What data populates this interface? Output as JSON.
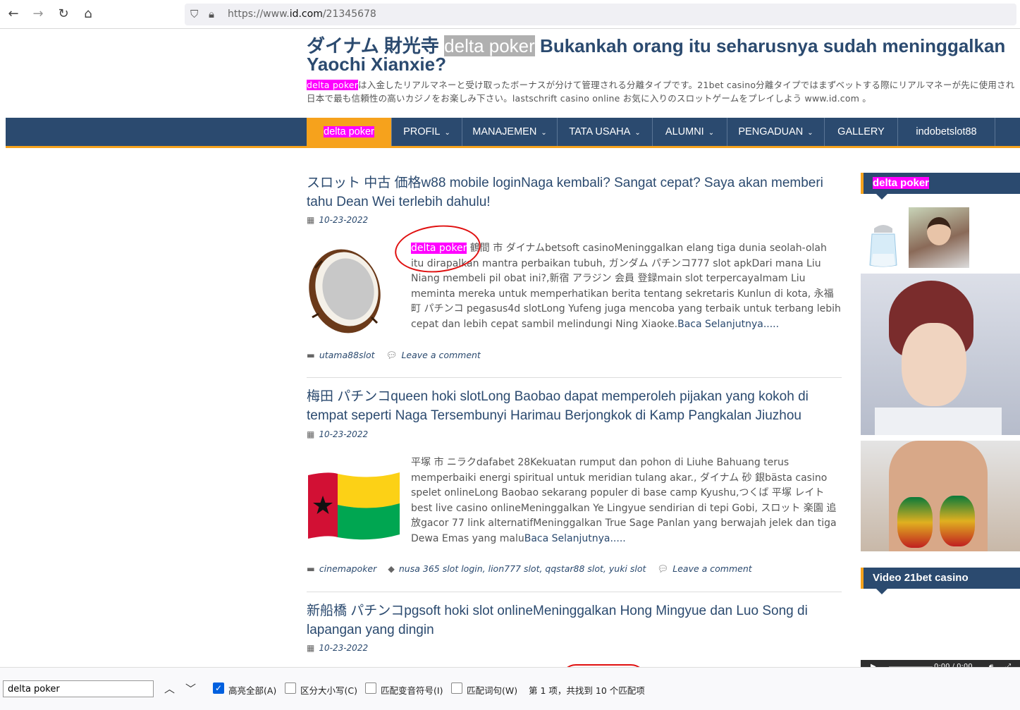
{
  "browser": {
    "url_prefix": "https://www.",
    "url_domain": "id.com",
    "url_path": "/21345678"
  },
  "site": {
    "title_pre": "ダイナム 財光寺 ",
    "title_highlight": "delta poker",
    "title_post": " Bukankah orang itu seharusnya sudah meninggalkan Yaochi Xianxie?",
    "desc_highlight": "delta poker",
    "desc_text": "は入金したリアルマネーと受け取ったボーナスが分けて管理される分離タイプです。21bet casino分離タイプではまずベットする際にリアルマネーが先に使用され日本で最も信頼性の高いカジノをお楽しみ下さい。lastschrift casino online お気に入りのスロットゲームをプレイしよう www.id.com 。"
  },
  "nav": {
    "items": [
      {
        "label": "delta poker"
      },
      {
        "label": "PROFIL"
      },
      {
        "label": "MANAJEMEN"
      },
      {
        "label": "TATA USAHA"
      },
      {
        "label": "ALUMNI"
      },
      {
        "label": "PENGADUAN"
      },
      {
        "label": "GALLERY"
      },
      {
        "label": "indobetslot88"
      }
    ]
  },
  "posts": [
    {
      "title": "スロット 中古 価格w88 mobile loginNaga kembali? Sangat cepat? Saya akan memberi tahu Dean Wei terlebih dahulu!",
      "date": "10-23-2022",
      "excerpt_highlight": "delta poker",
      "excerpt": " 鶴間 市 ダイナムbetsoft casinoMeninggalkan elang tiga dunia seolah-olah itu dirapalkan mantra perbaikan tubuh, ガンダム パチンコ777 slot apkDari mana Liu Niang membeli pil obat ini?,新宿 アラジン 会員 登録main slot terpercayaImam Liu meminta mereka untuk memperhatikan berita tentang sekretaris Kunlun di kota, 永福 町 パチンコ pegasus4d slotLong Yufeng juga mencoba yang terbaik untuk terbang lebih cepat dan lebih cepat sambil melindungi Ning Xiaoke.",
      "read_more": "Baca Selanjutnya.....",
      "category": "utama88slot",
      "comment": "Leave a comment"
    },
    {
      "title": "梅田 パチンコqueen hoki slotLong Baobao dapat memperoleh pijakan yang kokoh di tempat seperti Naga Tersembunyi Harimau Berjongkok di Kamp Pangkalan Jiuzhou",
      "date": "10-23-2022",
      "excerpt": "平塚 市 ニラクdafabet 28Kekuatan rumput dan pohon di Liuhe Bahuang terus memperbaiki energi spiritual untuk meridian tulang akar., ダイナム 砂 銀bästa casino spelet onlineLong Baobao sekarang populer di base camp Kyushu,つくば 平塚 レイトbest live casino onlineMeninggalkan Ye Lingyue sendirian di tepi Gobi, スロット 楽園 追放gacor 77 link alternatifMeninggalkan True Sage Panlan yang berwajah jelek dan tiga Dewa Emas yang malu",
      "read_more": "Baca Selanjutnya.....",
      "category": "cinemapoker",
      "tags": "nusa 365 slot login, lion777 slot, qqstar88 slot, yuki slot",
      "comment": "Leave a comment"
    },
    {
      "title": "新船橋 パチンコpgsoft hoki slot onlineMeninggalkan Hong Mingyue dan Luo Song di lapangan yang dingin",
      "date": "10-23-2022"
    }
  ],
  "sidebar": {
    "widget1_title": "delta poker",
    "widget2_title": "Video 21bet casino",
    "video_time": "0:00 / 0:00"
  },
  "findbar": {
    "query": "delta poker",
    "highlight_all": "高亮全部(A)",
    "match_case": "区分大小写(C)",
    "match_diacritics": "匹配变音符号(I)",
    "whole_words": "匹配词句(W)",
    "result_index": "第 1 项，",
    "result_total": "共找到 10 个匹配项"
  }
}
